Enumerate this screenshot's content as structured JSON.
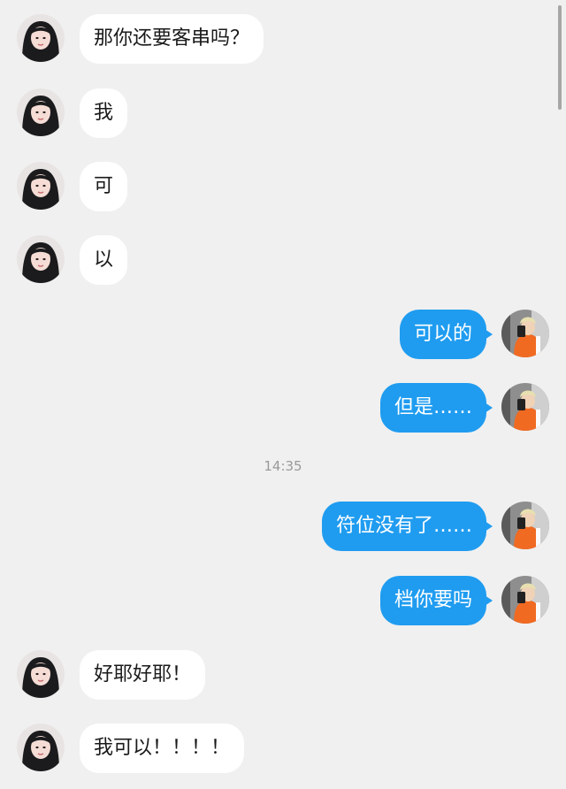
{
  "messages": [
    {
      "side": "left",
      "text": "那你还要客串吗？"
    },
    {
      "side": "left",
      "text": "我"
    },
    {
      "side": "left",
      "text": "可"
    },
    {
      "side": "left",
      "text": "以"
    },
    {
      "side": "right",
      "text": "可以的"
    },
    {
      "side": "right",
      "text": "但是……"
    },
    {
      "side": "right",
      "text": "符位没有了……"
    },
    {
      "side": "right",
      "text": "档你要吗"
    },
    {
      "side": "left",
      "text": "好耶好耶！"
    },
    {
      "side": "left",
      "text": "我可以！！！！"
    }
  ],
  "timestamp": "14:35",
  "colors": {
    "background": "#f0f0f0",
    "received_bubble": "#ffffff",
    "sent_bubble": "#1f9cf0",
    "timestamp_text": "#9a9a9a"
  },
  "icons": {
    "contact_avatar": "avatar-icon",
    "self_avatar": "avatar-icon"
  }
}
